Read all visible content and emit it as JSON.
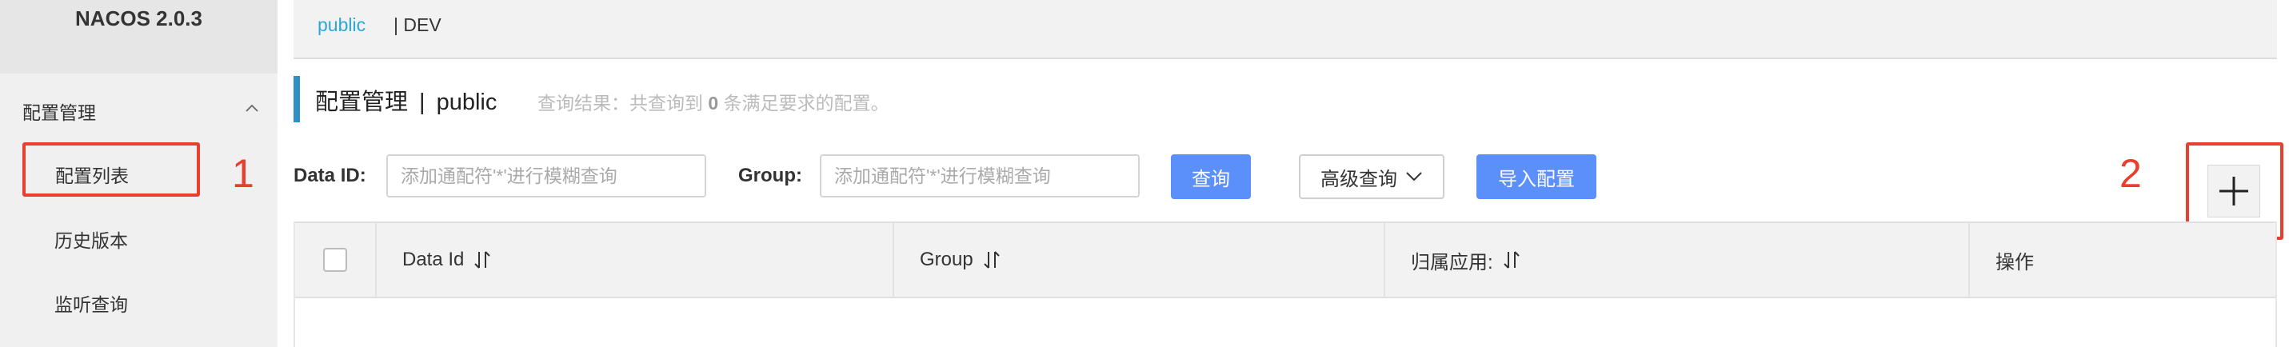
{
  "app": {
    "logo": "NACOS 2.0.3"
  },
  "sidebar": {
    "group_label": "配置管理",
    "items": [
      {
        "label": "配置列表"
      },
      {
        "label": "历史版本"
      },
      {
        "label": "监听查询"
      }
    ]
  },
  "annotations": {
    "one": "1",
    "two": "2"
  },
  "namespace": {
    "active": "public",
    "other": "| DEV"
  },
  "header": {
    "title": "配置管理",
    "separator": "|",
    "namespace": "public",
    "result_prefix": "查询结果：共查询到",
    "result_count": "0",
    "result_suffix": "条满足要求的配置。"
  },
  "filters": {
    "data_id_label": "Data ID:",
    "data_id_placeholder": "添加通配符'*'进行模糊查询",
    "group_label": "Group:",
    "group_placeholder": "添加通配符'*'进行模糊查询",
    "search_button": "查询",
    "advanced_button": "高级查询",
    "import_button": "导入配置"
  },
  "table": {
    "columns": [
      "Data Id",
      "Group",
      "归属应用:",
      "操作"
    ]
  },
  "colors": {
    "accent": "#5b8ff9",
    "link": "#2ba7d8",
    "annotation": "#e8402e"
  }
}
